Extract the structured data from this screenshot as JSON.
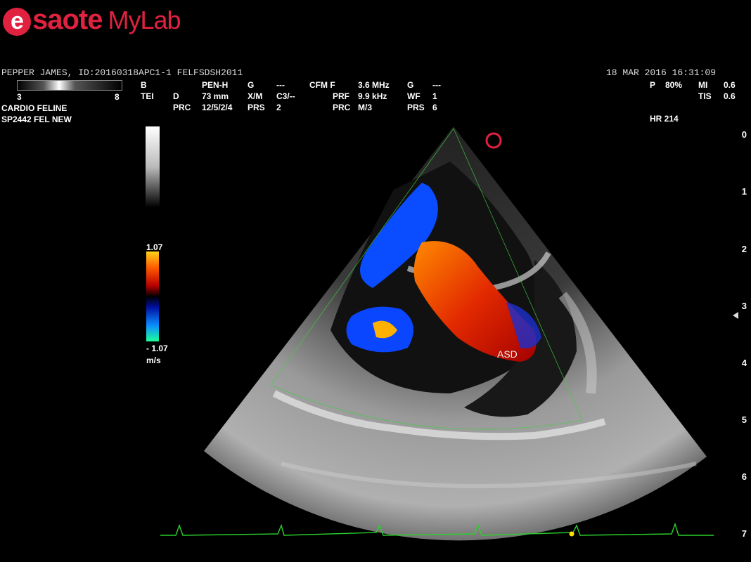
{
  "logo": {
    "brand": "saote",
    "e": "e",
    "product": "MyLab"
  },
  "header": {
    "patient": "PEPPER JAMES, ID:20160318APC1-1  FELFSDSH2011",
    "date": "18  MAR  2016 16:31:09",
    "gray_min": "3",
    "gray_max": "8",
    "preset": "CARDIO FELINE",
    "probe": "SP2442  FEL NEW"
  },
  "params": {
    "b": "B",
    "tei": "TEI",
    "pen_h": "PEN-H",
    "d": "D",
    "d_val": "73 mm",
    "prc": "PRC",
    "prc_val": "12/5/2/4",
    "g": "G",
    "g_val": "---",
    "xm": "X/M",
    "xm_val": "C3/--",
    "prs": "PRS",
    "prs_val": "2",
    "cfm": "CFM F",
    "cfm_val": "3.6 MHz",
    "prf": "PRF",
    "prf_val": "9.9 kHz",
    "cprc": "PRC",
    "cprc_val": "M/3",
    "cg": "G",
    "cg_val": "---",
    "wf": "WF",
    "wf_val": "1",
    "cprs": "PRS",
    "cprs_val": "6",
    "p": "P",
    "p_val": "80%",
    "mi": "MI",
    "mi_val": "0.6",
    "tis": "TIS",
    "tis_val": "0.6",
    "hr": "HR 214"
  },
  "scale": {
    "top": "1.07",
    "bottom": "- 1.07",
    "unit": "m/s"
  },
  "depth_ticks": [
    "0",
    "1",
    "2",
    "3",
    "4",
    "5",
    "6",
    "7"
  ],
  "annotation": "ASD",
  "colors": {
    "brand": "#e0213f",
    "ecg": "#2bd12b"
  }
}
